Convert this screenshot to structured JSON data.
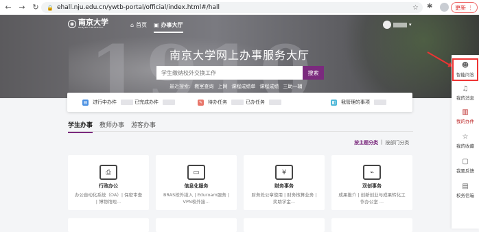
{
  "browser": {
    "url": "ehall.nju.edu.cn/ywtb-portal/official/index.html#/hall",
    "update_label": "更新",
    "icons": [
      "back-icon",
      "forward-icon",
      "reload-icon",
      "lock-icon",
      "star-icon",
      "extensions-icon"
    ]
  },
  "header": {
    "logo_text": "南京大学",
    "logo_sub": "NANJING UNIVERSITY",
    "nav": [
      {
        "label": "首页"
      },
      {
        "label": "办事大厅"
      }
    ],
    "page_title": "南京大学网上办事服务大厅",
    "search": {
      "placeholder": "学生缴纳校外交换工作",
      "button": "搜索"
    },
    "recent_label": "最近搜索:",
    "recent": [
      "教室查询",
      "上网",
      "课程成绩单",
      "课程成绩",
      "三助一辅"
    ]
  },
  "tasks": [
    {
      "label": "进行中办件",
      "badge": "0",
      "color": "#4a90e2"
    },
    {
      "label": "已完成办件",
      "badge": "0",
      "color": ""
    },
    {
      "label": "待办任务",
      "badge": "0",
      "color": "#e8766a"
    },
    {
      "label": "已办任务",
      "badge": "",
      "color": ""
    },
    {
      "label": "我管理的事项",
      "badge": "",
      "color": "#4fb8d8"
    }
  ],
  "tabs": [
    {
      "label": "学生办事"
    },
    {
      "label": "教师办事"
    },
    {
      "label": "游客办事"
    }
  ],
  "classify": {
    "by_theme": "按主题分类",
    "sep": "|",
    "by_dept": "按部门分类"
  },
  "cards": [
    {
      "title": "行政办公",
      "desc": "办公自动化系统（OA）| 保密审查 | 博物馆观..."
    },
    {
      "title": "信息化服务",
      "desc": "BRAS校外拨入 | Eduroam服务 | VPN校外接..."
    },
    {
      "title": "财务事务",
      "desc": "财务处公章使用 | 财务核算业务 | 奖助学金..."
    },
    {
      "title": "双创事务",
      "desc": "成果推介 | 创新创业与成果转化工作办公室 ..."
    }
  ],
  "sidebar": [
    {
      "label": "智能问答"
    },
    {
      "label": "我的消息"
    },
    {
      "label": "我的办件"
    },
    {
      "label": "我的收藏"
    },
    {
      "label": "我要反馈"
    },
    {
      "label": "校务信箱"
    }
  ],
  "colors": {
    "brand": "#7b2a7e",
    "highlight": "#e33333"
  }
}
